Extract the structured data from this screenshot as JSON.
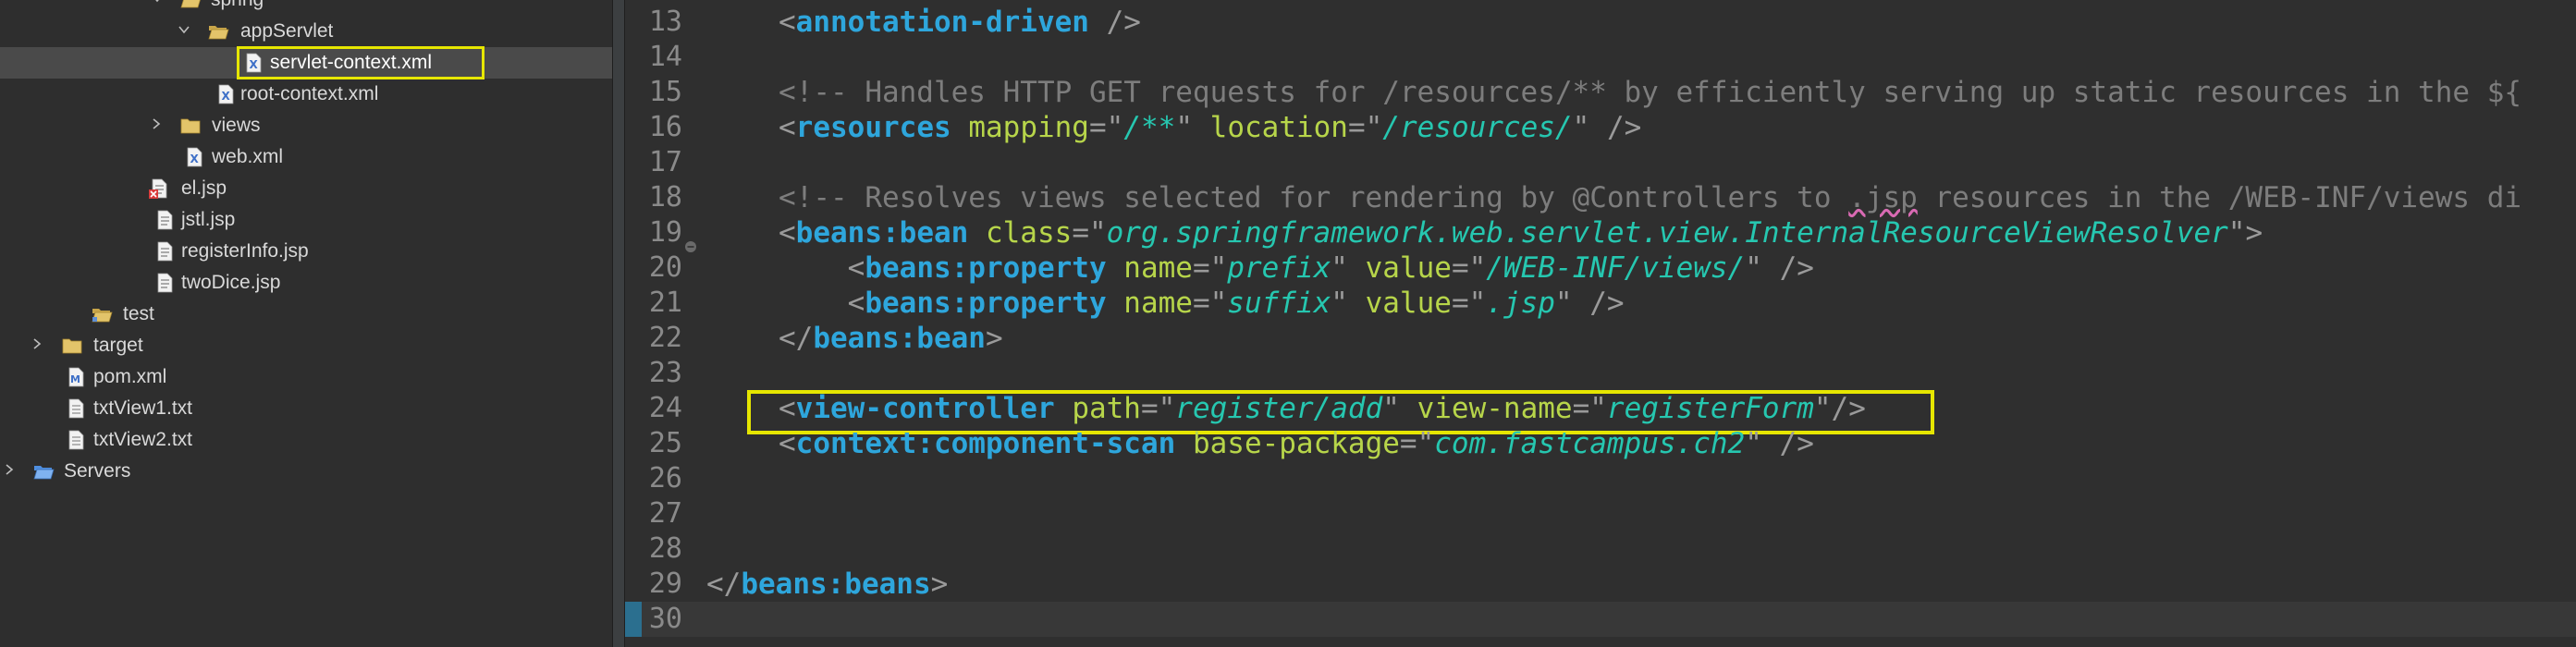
{
  "explorer": {
    "items": [
      {
        "label": "spring",
        "type": "folder",
        "expanded": true,
        "indent": 0
      },
      {
        "label": "appServlet",
        "type": "folder",
        "expanded": true,
        "indent": 1
      },
      {
        "label": "servlet-context.xml",
        "type": "xml-file",
        "selected": true,
        "highlighted": true
      },
      {
        "label": "root-context.xml",
        "type": "xml-file"
      },
      {
        "label": "views",
        "type": "folder",
        "expanded": false
      },
      {
        "label": "web.xml",
        "type": "xml-file"
      },
      {
        "label": "el.jsp",
        "type": "jsp-file-error"
      },
      {
        "label": "jstl.jsp",
        "type": "jsp-file"
      },
      {
        "label": "registerInfo.jsp",
        "type": "jsp-file"
      },
      {
        "label": "twoDice.jsp",
        "type": "jsp-file"
      },
      {
        "label": "test",
        "type": "folder-package"
      },
      {
        "label": "target",
        "type": "folder",
        "expanded": false
      },
      {
        "label": "pom.xml",
        "type": "maven-file"
      },
      {
        "label": "txtView1.txt",
        "type": "text-file"
      },
      {
        "label": "txtView2.txt",
        "type": "text-file"
      },
      {
        "label": "Servers",
        "type": "folder",
        "expanded": false
      }
    ]
  },
  "editor": {
    "lines": [
      {
        "num": "13",
        "tokens": [
          [
            "punc",
            "<"
          ],
          [
            "tag",
            "annotation-driven"
          ],
          [
            "plain",
            " "
          ],
          [
            "punc",
            "/>"
          ]
        ]
      },
      {
        "num": "14",
        "tokens": []
      },
      {
        "num": "15",
        "tokens": [
          [
            "comment",
            "<!-- Handles HTTP GET requests for /resources/** by efficiently serving up static resources in the ${"
          ]
        ]
      },
      {
        "num": "16",
        "tokens": [
          [
            "punc",
            "<"
          ],
          [
            "tag",
            "resources"
          ],
          [
            "plain",
            " "
          ],
          [
            "attr",
            "mapping"
          ],
          [
            "punc",
            "=\""
          ],
          [
            "str",
            "/**"
          ],
          [
            "punc",
            "\""
          ],
          [
            "plain",
            " "
          ],
          [
            "attr",
            "location"
          ],
          [
            "punc",
            "=\""
          ],
          [
            "str",
            "/resources/"
          ],
          [
            "punc",
            "\""
          ],
          [
            "plain",
            " "
          ],
          [
            "punc",
            "/>"
          ]
        ]
      },
      {
        "num": "17",
        "tokens": []
      },
      {
        "num": "18",
        "tokens": [
          [
            "comment",
            "<!-- Resolves views selected for rendering by @Controllers to "
          ],
          [
            "comment-warn",
            ".jsp"
          ],
          [
            "comment",
            " resources in the /WEB-INF/views di"
          ]
        ]
      },
      {
        "num": "19",
        "fold": true,
        "tokens": [
          [
            "punc",
            "<"
          ],
          [
            "tag",
            "beans:bean"
          ],
          [
            "plain",
            " "
          ],
          [
            "attr",
            "class"
          ],
          [
            "punc",
            "=\""
          ],
          [
            "str",
            "org.springframework.web.servlet.view.InternalResourceViewResolver"
          ],
          [
            "punc",
            "\">"
          ]
        ]
      },
      {
        "num": "20",
        "tokens": [
          [
            "plain",
            "    "
          ],
          [
            "punc",
            "<"
          ],
          [
            "tag",
            "beans:property"
          ],
          [
            "plain",
            " "
          ],
          [
            "attr",
            "name"
          ],
          [
            "punc",
            "=\""
          ],
          [
            "str",
            "prefix"
          ],
          [
            "punc",
            "\""
          ],
          [
            "plain",
            " "
          ],
          [
            "attr",
            "value"
          ],
          [
            "punc",
            "=\""
          ],
          [
            "str",
            "/WEB-INF/views/"
          ],
          [
            "punc",
            "\""
          ],
          [
            "plain",
            " "
          ],
          [
            "punc",
            "/>"
          ]
        ]
      },
      {
        "num": "21",
        "tokens": [
          [
            "plain",
            "    "
          ],
          [
            "punc",
            "<"
          ],
          [
            "tag",
            "beans:property"
          ],
          [
            "plain",
            " "
          ],
          [
            "attr",
            "name"
          ],
          [
            "punc",
            "=\""
          ],
          [
            "str",
            "suffix"
          ],
          [
            "punc",
            "\""
          ],
          [
            "plain",
            " "
          ],
          [
            "attr",
            "value"
          ],
          [
            "punc",
            "=\""
          ],
          [
            "str",
            ".jsp"
          ],
          [
            "punc",
            "\""
          ],
          [
            "plain",
            " "
          ],
          [
            "punc",
            "/>"
          ]
        ]
      },
      {
        "num": "22",
        "tokens": [
          [
            "punc",
            "</"
          ],
          [
            "tag",
            "beans:bean"
          ],
          [
            "punc",
            ">"
          ]
        ]
      },
      {
        "num": "23",
        "tokens": []
      },
      {
        "num": "24",
        "highlighted": true,
        "tokens": [
          [
            "punc",
            "<"
          ],
          [
            "tag",
            "view-controller"
          ],
          [
            "plain",
            " "
          ],
          [
            "attr",
            "path"
          ],
          [
            "punc",
            "=\""
          ],
          [
            "str",
            "register/add"
          ],
          [
            "punc",
            "\""
          ],
          [
            "plain",
            " "
          ],
          [
            "attr",
            "view-name"
          ],
          [
            "punc",
            "=\""
          ],
          [
            "str",
            "registerForm"
          ],
          [
            "punc",
            "\"/>"
          ]
        ]
      },
      {
        "num": "25",
        "tokens": [
          [
            "punc",
            "<"
          ],
          [
            "tag",
            "context:component-scan"
          ],
          [
            "plain",
            " "
          ],
          [
            "attr",
            "base-package"
          ],
          [
            "punc",
            "=\""
          ],
          [
            "str",
            "com.fastcampus.ch2"
          ],
          [
            "punc",
            "\""
          ],
          [
            "plain",
            " "
          ],
          [
            "punc",
            "/>"
          ]
        ]
      },
      {
        "num": "26",
        "tokens": []
      },
      {
        "num": "27",
        "tokens": []
      },
      {
        "num": "28",
        "tokens": []
      },
      {
        "num": "29",
        "outdent": true,
        "tokens": [
          [
            "punc",
            "</"
          ],
          [
            "tag",
            "beans:beans"
          ],
          [
            "punc",
            ">"
          ]
        ]
      },
      {
        "num": "30",
        "current": true,
        "tokens": []
      }
    ]
  },
  "colors": {
    "highlight_box": "#e6e600",
    "tag": "#2ea6dc",
    "attribute": "#b7d54a",
    "string": "#26c7b0",
    "comment": "#7d7d7d"
  }
}
